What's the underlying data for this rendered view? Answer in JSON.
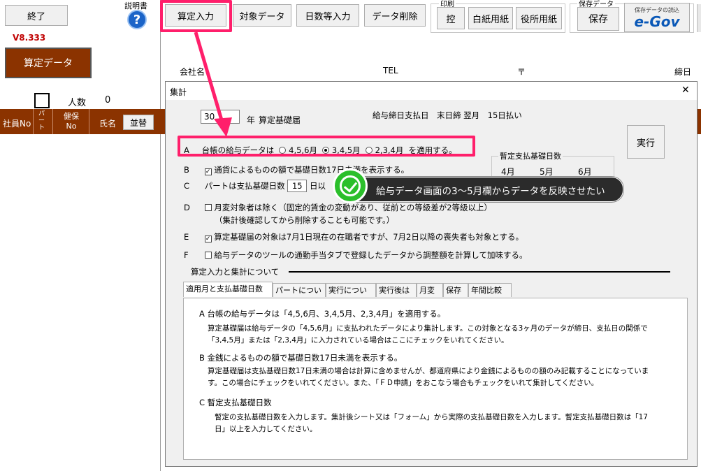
{
  "toolbar": {
    "exit": "終了",
    "version": "V8.333",
    "manual_label": "説明書",
    "manual_icon": "?",
    "santei_data": "算定データ",
    "santei_input": "算定入力",
    "target_data": "対象データ",
    "days_input": "日数等入力",
    "data_delete": "データ削除",
    "print_label": "印刷",
    "ko": "控",
    "blank_paper": "白紙用紙",
    "office_paper": "役所用紙",
    "save_group_label": "保存データ",
    "save": "保存",
    "egov_caption": "保存データの読込",
    "egov_logo": "e-Gov"
  },
  "sheet": {
    "company": "会社名",
    "tel": "TEL",
    "postal": "〒",
    "deadline": "締日",
    "headcount_label": "人数",
    "headcount": "0",
    "cols": [
      "社員No",
      "パート",
      "健保 No",
      "氏名"
    ],
    "sort_button": "並替"
  },
  "dialog": {
    "title": "集計",
    "close": "✕",
    "year_value": "30",
    "year_label": "年",
    "doc_label": "算定基礎届",
    "pay_info": "給与締日支払日　末日締 翌月　15日払い",
    "run_button": "実行",
    "row_a": {
      "letter": "A",
      "prefix": "台帳の給与データは",
      "opt1": "4,5,6月",
      "opt2": "3,4,5月",
      "opt3": "2,3,4月",
      "suffix": "を適用する。"
    },
    "row_b": {
      "letter": "B",
      "text": "通貨によるものの額で基礎日数17日未満を表示する。"
    },
    "row_c": {
      "letter": "C",
      "prefix": "パートは支払基礎日数",
      "value": "15",
      "suffix": "日以"
    },
    "row_d": {
      "letter": "D",
      "text": "月変対象者は除く（固定的賃金の変動があり、従前との等級差が2等級以上）",
      "sub": "（集計後確認してから削除することも可能です。）"
    },
    "row_e": {
      "letter": "E",
      "text": "算定基礎届の対象は7月1日現在の在職者ですが、7月2日以降の喪失者も対象とする。"
    },
    "row_f": {
      "letter": "F",
      "text": "給与データのツールの通勤手当タブで登録したデータから調整額を計算して加味する。"
    },
    "provisional": {
      "title": "暫定支払基礎日数",
      "months": [
        "4月",
        "5月",
        "6月"
      ]
    },
    "section_title": "算定入力と集計について",
    "tabs": [
      "適用月と支払基礎日数",
      "パートについて",
      "実行について",
      "実行後は",
      "月変",
      "保存",
      "年間比較"
    ],
    "help": {
      "a_head": "A  台帳の給与データは「4,5,6月、3,4,5月、2,3,4月」を適用する。",
      "a_body1": "算定基礎届は給与データの「4,5,6月」に支払われたデータにより集計します。この対象となる3ヶ月のデータが締日、支払日の関係で",
      "a_body2": "「3,4,5月」または「2,3,4月」に入力されている場合はここにチェックをいれてください。",
      "b_head": "B  金銭によるものの額で基礎日数17日未満を表示する。",
      "b_body1": "算定基礎届は支払基礎日数17日未満の場合は計算に含めませんが、都道府県により金銭によるものの額のみ記載することになっていま",
      "b_body2": "す。この場合にチェックをいれてください。また、「ＦＤ申請」をおこなう場合もチェックをいれて集計してください。",
      "c_head": "C  暫定支払基礎日数",
      "c_body1": "暫定の支払基礎日数を入力します。集計後シート又は「フォーム」から実際の支払基礎日数を入力します。暫定支払基礎日数は「17",
      "c_body2": "日」以上を入力してください。"
    }
  },
  "annotation": {
    "callout": "給与データ画面の3～5月欄からデータを反映させたい",
    "highlight_color": "#ff1f6b"
  }
}
